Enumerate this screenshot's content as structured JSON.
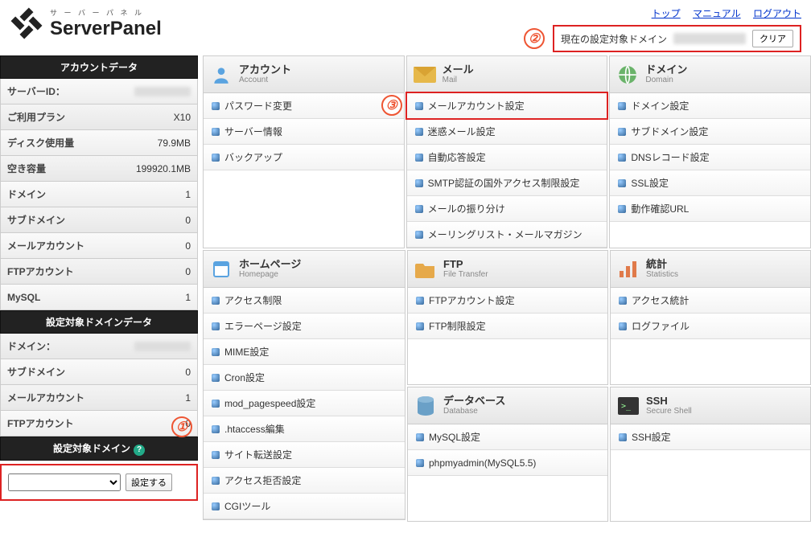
{
  "brand": {
    "kata": "サ ー バ ー パ ネ ル",
    "name": "ServerPanel"
  },
  "topnav": {
    "top": "トップ",
    "manual": "マニュアル",
    "logout": "ログアウト"
  },
  "current_domain": {
    "label": "現在の設定対象ドメイン",
    "clear": "クリア"
  },
  "step_labels": {
    "one": "①",
    "two": "②",
    "three": "③"
  },
  "sidebar": {
    "account_title": "アカウントデータ",
    "rows": [
      {
        "label": "サーバーID：",
        "value": ""
      },
      {
        "label": "ご利用プラン",
        "value": "X10"
      },
      {
        "label": "ディスク使用量",
        "value": "79.9MB"
      },
      {
        "label": "空き容量",
        "value": "199920.1MB"
      },
      {
        "label": "ドメイン",
        "value": "1"
      },
      {
        "label": "サブドメイン",
        "value": "0"
      },
      {
        "label": "メールアカウント",
        "value": "0"
      },
      {
        "label": "FTPアカウント",
        "value": "0"
      },
      {
        "label": "MySQL",
        "value": "1"
      }
    ],
    "domain_data_title": "設定対象ドメインデータ",
    "drows": [
      {
        "label": "ドメイン：",
        "value": ""
      },
      {
        "label": "サブドメイン",
        "value": "0"
      },
      {
        "label": "メールアカウント",
        "value": "1"
      },
      {
        "label": "FTPアカウント",
        "value": "0"
      }
    ],
    "target_title": "設定対象ドメイン",
    "set_button": "設定する"
  },
  "panels": {
    "account": {
      "jp": "アカウント",
      "en": "Account",
      "items": [
        "パスワード変更",
        "サーバー情報",
        "バックアップ"
      ]
    },
    "mail": {
      "jp": "メール",
      "en": "Mail",
      "items": [
        "メールアカウント設定",
        "迷惑メール設定",
        "自動応答設定",
        "SMTP認証の国外アクセス制限設定",
        "メールの振り分け",
        "メーリングリスト・メールマガジン"
      ]
    },
    "domain": {
      "jp": "ドメイン",
      "en": "Domain",
      "items": [
        "ドメイン設定",
        "サブドメイン設定",
        "DNSレコード設定",
        "SSL設定",
        "動作確認URL"
      ]
    },
    "homepage": {
      "jp": "ホームページ",
      "en": "Homepage",
      "items": [
        "アクセス制限",
        "エラーページ設定",
        "MIME設定",
        "Cron設定",
        "mod_pagespeed設定",
        ".htaccess編集",
        "サイト転送設定",
        "アクセス拒否設定",
        "CGIツール"
      ]
    },
    "ftp": {
      "jp": "FTP",
      "en": "File Transfer",
      "items": [
        "FTPアカウント設定",
        "FTP制限設定"
      ]
    },
    "stats": {
      "jp": "統計",
      "en": "Statistics",
      "items": [
        "アクセス統計",
        "ログファイル"
      ]
    },
    "db": {
      "jp": "データベース",
      "en": "Database",
      "items": [
        "MySQL設定",
        "phpmyadmin(MySQL5.5)"
      ]
    },
    "ssh": {
      "jp": "SSH",
      "en": "Secure Shell",
      "items": [
        "SSH設定"
      ]
    }
  }
}
